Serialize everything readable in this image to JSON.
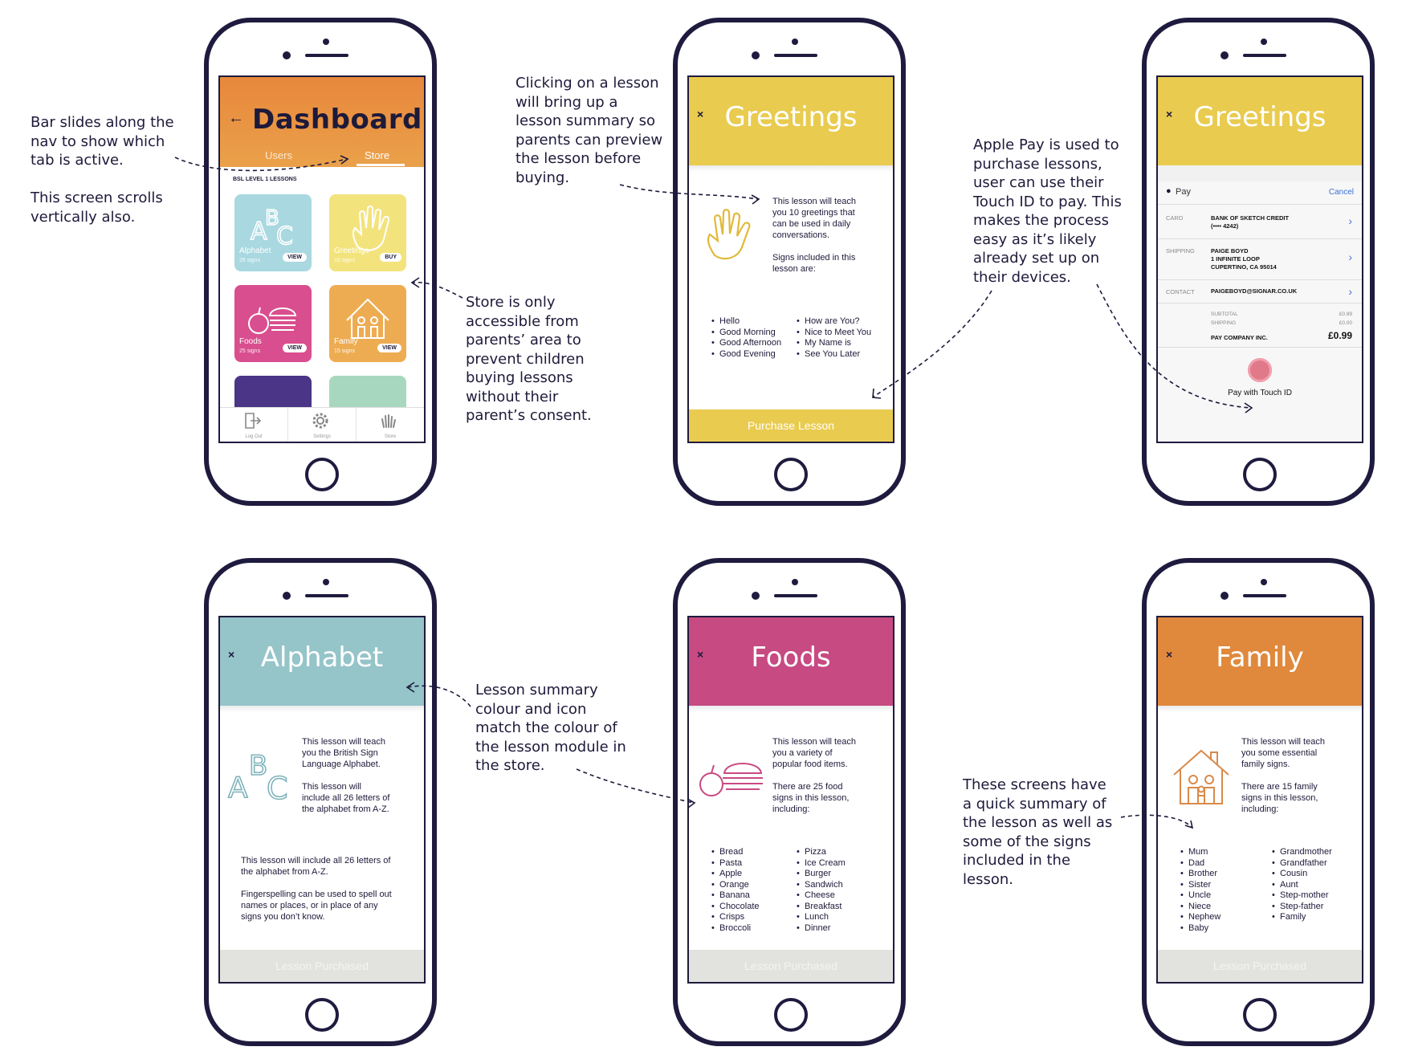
{
  "annotations": {
    "nav_bar": "Bar slides along the\nnav to show which\ntab is active.\n\nThis screen scrolls\nvertically also.",
    "store": "Store is only\naccessible from\nparents’ area to\nprevent children\nbuying lessons\nwithout their\nparent’s consent.",
    "lesson_click": "Clicking on a lesson\nwill bring up a\nlesson summary so\nparents can preview\nthe lesson before\nbuying.",
    "apple_pay": "Apple Pay is used to\npurchase lessons,\nuser can use their\nTouch ID to pay. This\nmakes the process\neasy as it’s likely\nalready set up on\ntheir devices.",
    "colour_match": "Lesson summary\ncolour and icon\nmatch the colour of\nthe lesson module in\nthe store.",
    "summary": "These screens have\na quick summary of\nthe lesson as well as\nsome of the signs\nincluded in the\nlesson."
  },
  "dashboard": {
    "back_icon": "←",
    "title": "Dashboard",
    "tabs": [
      "Users",
      "Store"
    ],
    "active_tab": "Store",
    "section_label": "BSL LEVEL 1 LESSONS",
    "tiles": [
      {
        "name": "Alphabet",
        "count": "26 signs",
        "button": "VIEW",
        "color": "#a9d8e0"
      },
      {
        "name": "Greetings",
        "count": "10 signs",
        "button": "BUY",
        "color": "#f3e37d"
      },
      {
        "name": "Foods",
        "count": "25 signs",
        "button": "VIEW",
        "color": "#d94e8e"
      },
      {
        "name": "Family",
        "count": "15 signs",
        "button": "VIEW",
        "color": "#eeac52"
      }
    ],
    "nav": [
      "Log Out",
      "Settings",
      "Store"
    ]
  },
  "greetings": {
    "close_icon": "×",
    "title": "Greetings",
    "color": "#e9cb4f",
    "summary": "This lesson will teach\nyou 10 greetings that\ncan be used in daily\nconversations.\n\nSigns included in this\nlesson are:",
    "signs_left": [
      "Hello",
      "Good Morning",
      "Good Afternoon",
      "Good Evening"
    ],
    "signs_right": [
      "How are You?",
      "Nice to Meet You",
      "My Name is",
      "See You Later"
    ],
    "footer": "Purchase Lesson"
  },
  "applepay": {
    "close_icon": "×",
    "title": "Greetings",
    "pay_label": "Pay",
    "cancel": "Cancel",
    "card_label": "CARD",
    "card_value": "BANK OF SKETCH CREDIT\n(•••• 4242)",
    "shipping_label": "SHIPPING",
    "shipping_value": "PAIGE BOYD\n1 INFINITE LOOP\nCUPERTINO, CA 95014",
    "contact_label": "CONTACT",
    "contact_value": "PAIGEBOYD@SIGNAR.CO.UK",
    "subtotal_label": "SUBTOTAL",
    "subtotal_value": "£0.99",
    "shipping_cost_label": "SHIPPING",
    "shipping_cost_value": "£0.00",
    "pay_company": "PAY COMPANY INC.",
    "total": "£0.99",
    "touch_id": "Pay with Touch ID"
  },
  "alphabet": {
    "close_icon": "×",
    "title": "Alphabet",
    "color": "#95c4c9",
    "summary": "This lesson will teach\nyou the British Sign\nLanguage Alphabet.\n\nThis lesson will\ninclude all 26 letters of\nthe alphabet from A-Z.",
    "detail": "This lesson will include all 26 letters of\nthe alphabet from A-Z.\n\nFingerspelling can be used to spell out\nnames or places, or in place of any\nsigns you don’t know.",
    "footer": "Lesson Purchased"
  },
  "foods": {
    "close_icon": "×",
    "title": "Foods",
    "color": "#c74a82",
    "summary": "This lesson will teach\nyou a variety of\npopular food items.\n\nThere are 25 food\nsigns in this lesson,\nincluding:",
    "signs_left": [
      "Bread",
      "Pasta",
      "Apple",
      "Orange",
      "Banana",
      "Chocolate",
      "Crisps",
      "Broccoli"
    ],
    "signs_right": [
      "Pizza",
      "Ice Cream",
      "Burger",
      "Sandwich",
      "Cheese",
      "Breakfast",
      "Lunch",
      "Dinner"
    ],
    "footer": "Lesson Purchased"
  },
  "family": {
    "close_icon": "×",
    "title": "Family",
    "color": "#e0893d",
    "summary": "This lesson will teach\nyou some essential\nfamily signs.\n\nThere are 15 family\nsigns in this lesson,\nincluding:",
    "signs_left": [
      "Mum",
      "Dad",
      "Brother",
      "Sister",
      "Uncle",
      "Niece",
      "Nephew",
      "Baby"
    ],
    "signs_right": [
      "Grandmother",
      "Grandfather",
      "Cousin",
      "Aunt",
      "Step-mother",
      "Step-father",
      "Family"
    ],
    "footer": "Lesson Purchased"
  }
}
